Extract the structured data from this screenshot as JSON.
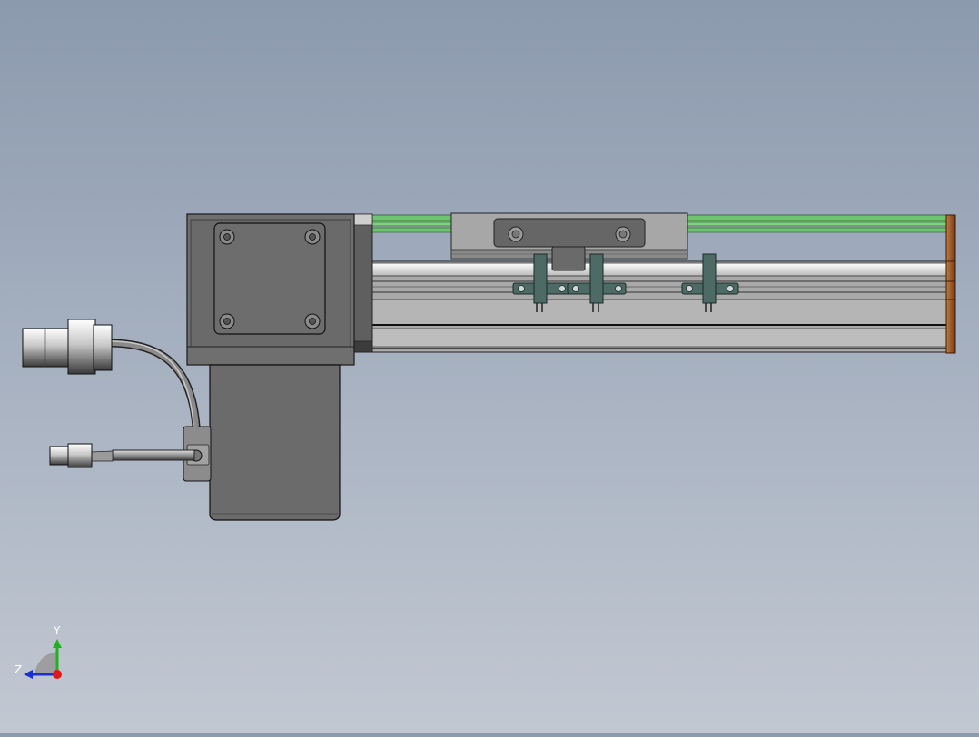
{
  "view": {
    "background_top": "#8c9aae",
    "background_bottom": "#c2c8d2"
  },
  "model": {
    "housing_color": "#6f6f6f",
    "rail_color": "#a9a9a9",
    "rail_highlight": "#f4f4f4",
    "guide_strip_color": "#6fc46f",
    "end_cap_color": "#9a5a2a",
    "sensor_bracket_color": "#4e6a64",
    "cable_color": "#5a5a5a",
    "connector_color": "#d8d8d8"
  },
  "triad": {
    "y_label": "Y",
    "z_label": "Z",
    "y_axis_color": "#22b022",
    "z_axis_color": "#1a2fd6",
    "x_origin_color": "#e01818"
  }
}
